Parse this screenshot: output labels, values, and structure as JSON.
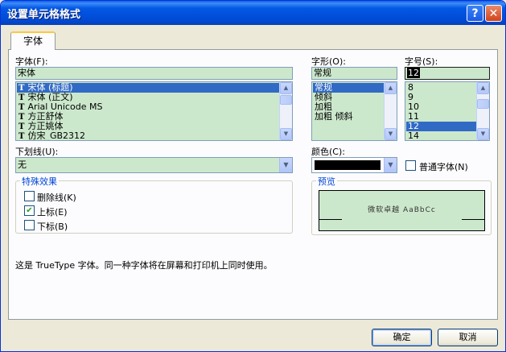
{
  "window": {
    "title": "设置单元格格式",
    "help_glyph": "?",
    "close_glyph": "✕"
  },
  "tabs": [
    {
      "label": "字体",
      "active": true
    }
  ],
  "font": {
    "label": "字体(F):",
    "value": "宋体",
    "items": [
      "宋体 (标题)",
      "宋体 (正文)",
      "Arial Unicode MS",
      "方正舒体",
      "方正姚体",
      "仿宋_GB2312"
    ],
    "selected_index": 0,
    "icon_glyph": "T"
  },
  "style": {
    "label": "字形(O):",
    "value": "常规",
    "items": [
      "常规",
      "倾斜",
      "加粗",
      "加粗 倾斜"
    ],
    "selected_index": 0
  },
  "size": {
    "label": "字号(S):",
    "value": "12",
    "items": [
      "8",
      "9",
      "10",
      "11",
      "12",
      "14"
    ],
    "selected_index": 4
  },
  "underline": {
    "label": "下划线(U):",
    "value": "无"
  },
  "color": {
    "label": "颜色(C):",
    "value_color": "#000000"
  },
  "normal_font": {
    "label": "普通字体(N)",
    "checked": false
  },
  "effects": {
    "title": "特殊效果",
    "strikethrough": {
      "label": "删除线(K)",
      "checked": false
    },
    "superscript": {
      "label": "上标(E)",
      "checked": true
    },
    "subscript": {
      "label": "下标(B)",
      "checked": false
    }
  },
  "preview": {
    "title": "预览",
    "sample": "微软卓越 AaBbCc"
  },
  "info_text": "这是 TrueType 字体。同一种字体将在屏幕和打印机上同时使用。",
  "buttons": {
    "ok": "确定",
    "cancel": "取消"
  },
  "icons": {
    "check": "✔",
    "down_arrow": "▼",
    "up_arrow": "▲"
  },
  "colors": {
    "title_bar": "#0150db",
    "field_bg": "#cce8cc",
    "selection": "#316ac5",
    "group_title": "#0046d5"
  }
}
